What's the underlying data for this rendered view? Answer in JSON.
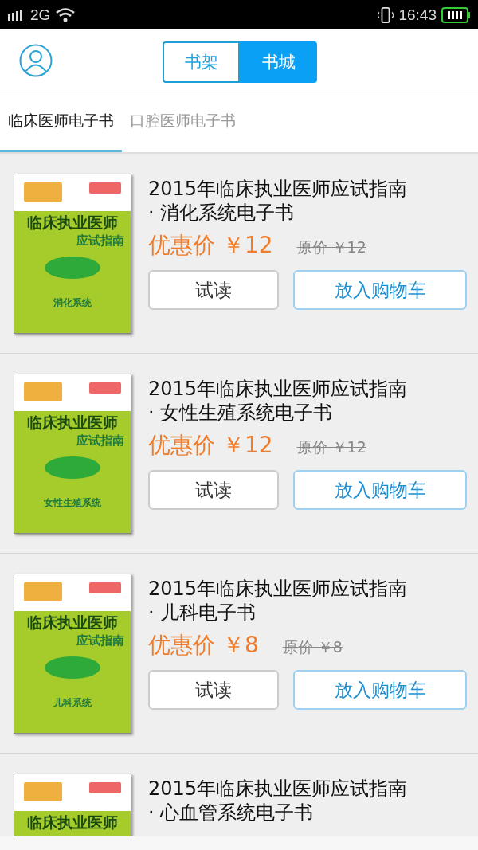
{
  "status_bar": {
    "network": "2G",
    "time": "16:43"
  },
  "header": {
    "segments": [
      {
        "label": "书架",
        "selected": false
      },
      {
        "label": "书城",
        "selected": true
      }
    ]
  },
  "categories": [
    {
      "label": "临床医师电子书",
      "selected": true
    },
    {
      "label": "口腔医师电子书",
      "selected": false
    }
  ],
  "books": [
    {
      "cover": {
        "title": "临床执业医师",
        "subtitle": "应试指南",
        "series": "消化系统"
      },
      "title": "2015年临床执业医师应试指南 · 消化系统电子书",
      "price": "优惠价 ￥12",
      "original_price": "原价 ￥12",
      "buttons": [
        "试读",
        "放入购物车"
      ]
    },
    {
      "cover": {
        "title": "临床执业医师",
        "subtitle": "应试指南",
        "series": "女性生殖系统"
      },
      "title": "2015年临床执业医师应试指南 · 女性生殖系统电子书",
      "price": "优惠价 ￥12",
      "original_price": "原价 ￥12",
      "buttons": [
        "试读",
        "放入购物车"
      ]
    },
    {
      "cover": {
        "title": "临床执业医师",
        "subtitle": "应试指南",
        "series": "儿科系统"
      },
      "title": "2015年临床执业医师应试指南 · 儿科电子书",
      "price": "优惠价 ￥8",
      "original_price": "原价 ￥8",
      "buttons": [
        "试读",
        "放入购物车"
      ]
    },
    {
      "cover": {
        "title": "临床执业医师"
      },
      "title": "2015年临床执业医师应试指南 · 心血管系统电子书"
    }
  ]
}
